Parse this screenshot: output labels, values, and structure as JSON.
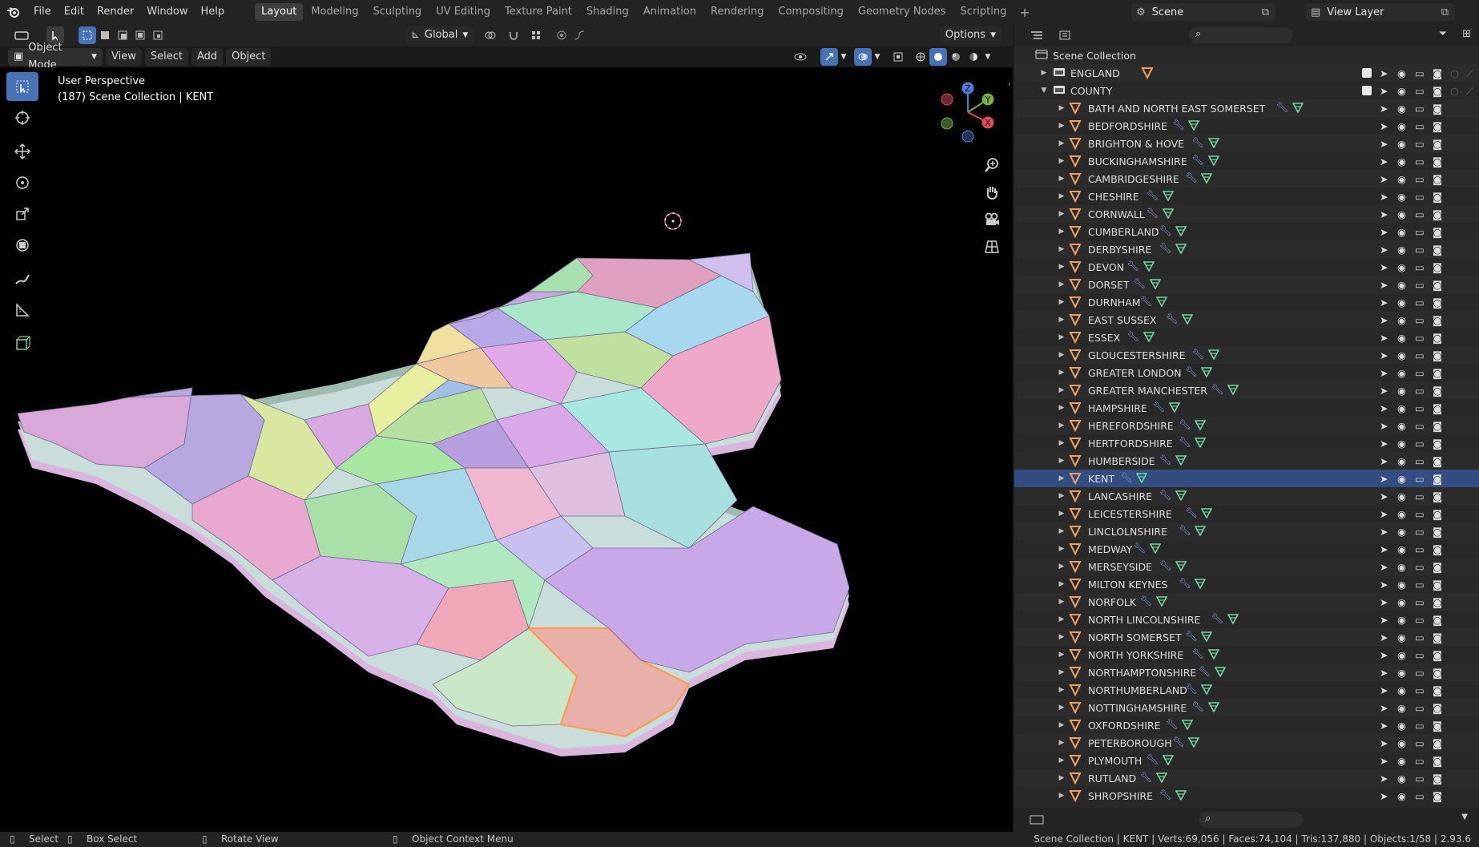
{
  "menu": [
    "File",
    "Edit",
    "Render",
    "Window",
    "Help"
  ],
  "workspaces": {
    "active": "Layout",
    "tabs": [
      "Layout",
      "Modeling",
      "Sculpting",
      "UV Editing",
      "Texture Paint",
      "Shading",
      "Animation",
      "Rendering",
      "Compositing",
      "Geometry Nodes",
      "Scripting"
    ]
  },
  "scene": {
    "name": "Scene",
    "view_layer": "View Layer"
  },
  "viewport_header": {
    "orientation": "Global",
    "options": "Options",
    "mode": "Object Mode",
    "menus": [
      "View",
      "Select",
      "Add",
      "Object"
    ]
  },
  "viewport": {
    "perspective": "User Perspective",
    "context": "(187) Scene Collection | KENT"
  },
  "outliner": {
    "root": "Scene Collection",
    "collections": [
      "ENGLAND",
      "COUNTY"
    ],
    "selected": "KENT",
    "objects": [
      "BATH AND NORTH EAST SOMERSET",
      "BEDFORDSHIRE",
      "BRIGHTON & HOVE",
      "BUCKINGHAMSHIRE",
      "CAMBRIDGESHIRE",
      "CHESHIRE",
      "CORNWALL",
      "CUMBERLAND",
      "DERBYSHIRE",
      "DEVON",
      "DORSET",
      "DURNHAM",
      "EAST SUSSEX",
      "ESSEX",
      "GLOUCESTERSHIRE",
      "GREATER LONDON",
      "GREATER MANCHESTER",
      "HAMPSHIRE",
      "HEREFORDSHIRE",
      "HERTFORDSHIRE",
      "HUMBERSIDE",
      "KENT",
      "LANCASHIRE",
      "LEICESTERSHIRE",
      "LINCLOLNSHIRE",
      "MEDWAY",
      "MERSEYSIDE",
      "MILTON KEYNES",
      "NORFOLK",
      "NORTH LINCOLNSHIRE",
      "NORTH SOMERSET",
      "NORTH YORKSHIRE",
      "NORTHAMPTONSHIRE",
      "NORTHUMBERLAND",
      "NOTTINGHAMSHIRE",
      "OXFORDSHIRE",
      "PETERBOROUGH",
      "PLYMOUTH",
      "RUTLAND",
      "SHROPSHIRE"
    ]
  },
  "statusbar": {
    "select": "Select",
    "box_select": "Box Select",
    "rotate_view": "Rotate View",
    "context_menu": "Object Context Menu",
    "stats": "Scene Collection | KENT | Verts:69,056 | Faces:74,104 | Tris:137,880 | Objects:1/58 | 2.93.6"
  },
  "colors": {
    "accent": "#4772b3",
    "selected_row": "#334d80",
    "object_icon": "#f0a060",
    "mesh_icon": "#6fd6a0",
    "wrench_icon": "#7e9be0"
  }
}
